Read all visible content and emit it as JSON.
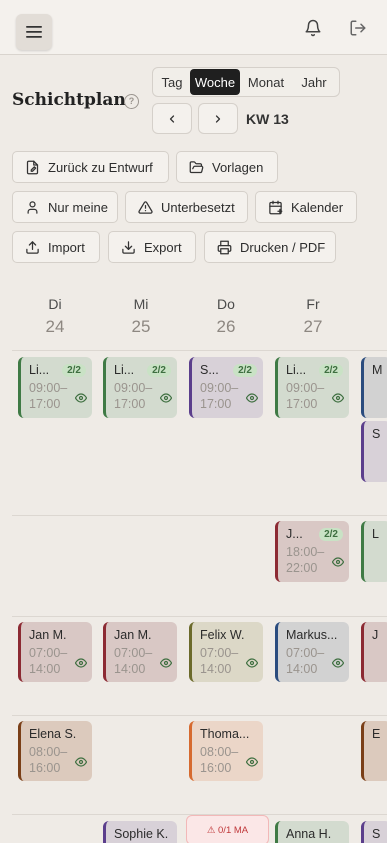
{
  "header": {
    "title": "Schichtplan",
    "help": "?"
  },
  "view_tabs": [
    {
      "label": "Tag",
      "active": false
    },
    {
      "label": "Woche",
      "active": true
    },
    {
      "label": "Monat",
      "active": false
    },
    {
      "label": "Jahr",
      "active": false
    }
  ],
  "week": {
    "label": "KW 13"
  },
  "actions": {
    "back_to_draft": "Zurück zu Entwurf",
    "templates": "Vorlagen",
    "only_mine": "Nur meine",
    "understaffed": "Unterbesetzt",
    "calendar": "Kalender",
    "import": "Import",
    "export": "Export",
    "print": "Drucken / PDF"
  },
  "days": [
    {
      "name": "Di",
      "num": "24"
    },
    {
      "name": "Mi",
      "num": "25"
    },
    {
      "name": "Do",
      "num": "26"
    },
    {
      "name": "Fr",
      "num": "27"
    }
  ],
  "shifts": {
    "r1": [
      {
        "name": "Li...",
        "badge": "2/2",
        "time": "09:00–17:00",
        "color": "#3f7a45"
      },
      {
        "name": "Li...",
        "badge": "2/2",
        "time": "09:00–17:00",
        "color": "#3f7a45"
      },
      {
        "name": "S...",
        "badge": "2/2",
        "time": "09:00–17:00",
        "color": "#5b3e8c"
      },
      {
        "name": "Li...",
        "badge": "2/2",
        "time": "09:00–17:00",
        "color": "#3f7a45"
      }
    ],
    "r1_partial": [
      {
        "name": "M",
        "color": "#2b4c7e"
      },
      {
        "name": "S",
        "color": "#5b3e8c"
      }
    ],
    "r2": {
      "name": "J...",
      "badge": "2/2",
      "time": "18:00–22:00",
      "color": "#8c2a33"
    },
    "r2_partial": {
      "name": "L",
      "color": "#3f7a45"
    },
    "r3": [
      {
        "name": "Jan M.",
        "time": "07:00–14:00",
        "color": "#8c2a33"
      },
      {
        "name": "Jan M.",
        "time": "07:00–14:00",
        "color": "#8c2a33"
      },
      {
        "name": "Felix W.",
        "time": "07:00–14:00",
        "color": "#6b6a2b"
      },
      {
        "name": "Markus...",
        "time": "07:00–14:00",
        "color": "#2b4c7e"
      }
    ],
    "r3_partial": {
      "name": "J",
      "color": "#8c2a33"
    },
    "r4": [
      {
        "name": "Elena S.",
        "time": "08:00–16:00",
        "color": "#7a3f18"
      },
      {
        "name": "Thoma...",
        "time": "08:00–16:00",
        "color": "#d66a2f"
      }
    ],
    "r4_partial": {
      "name": "E",
      "color": "#7a3f18"
    },
    "r5": [
      {
        "name": "Sophie K.",
        "color": "#5b3e8c"
      },
      {
        "name": "Anna H.",
        "color": "#3f7a45"
      }
    ],
    "r5_partial": {
      "name": "S",
      "color": "#5b3e8c"
    },
    "understaffed_badge": "⚠ 0/1 MA"
  }
}
